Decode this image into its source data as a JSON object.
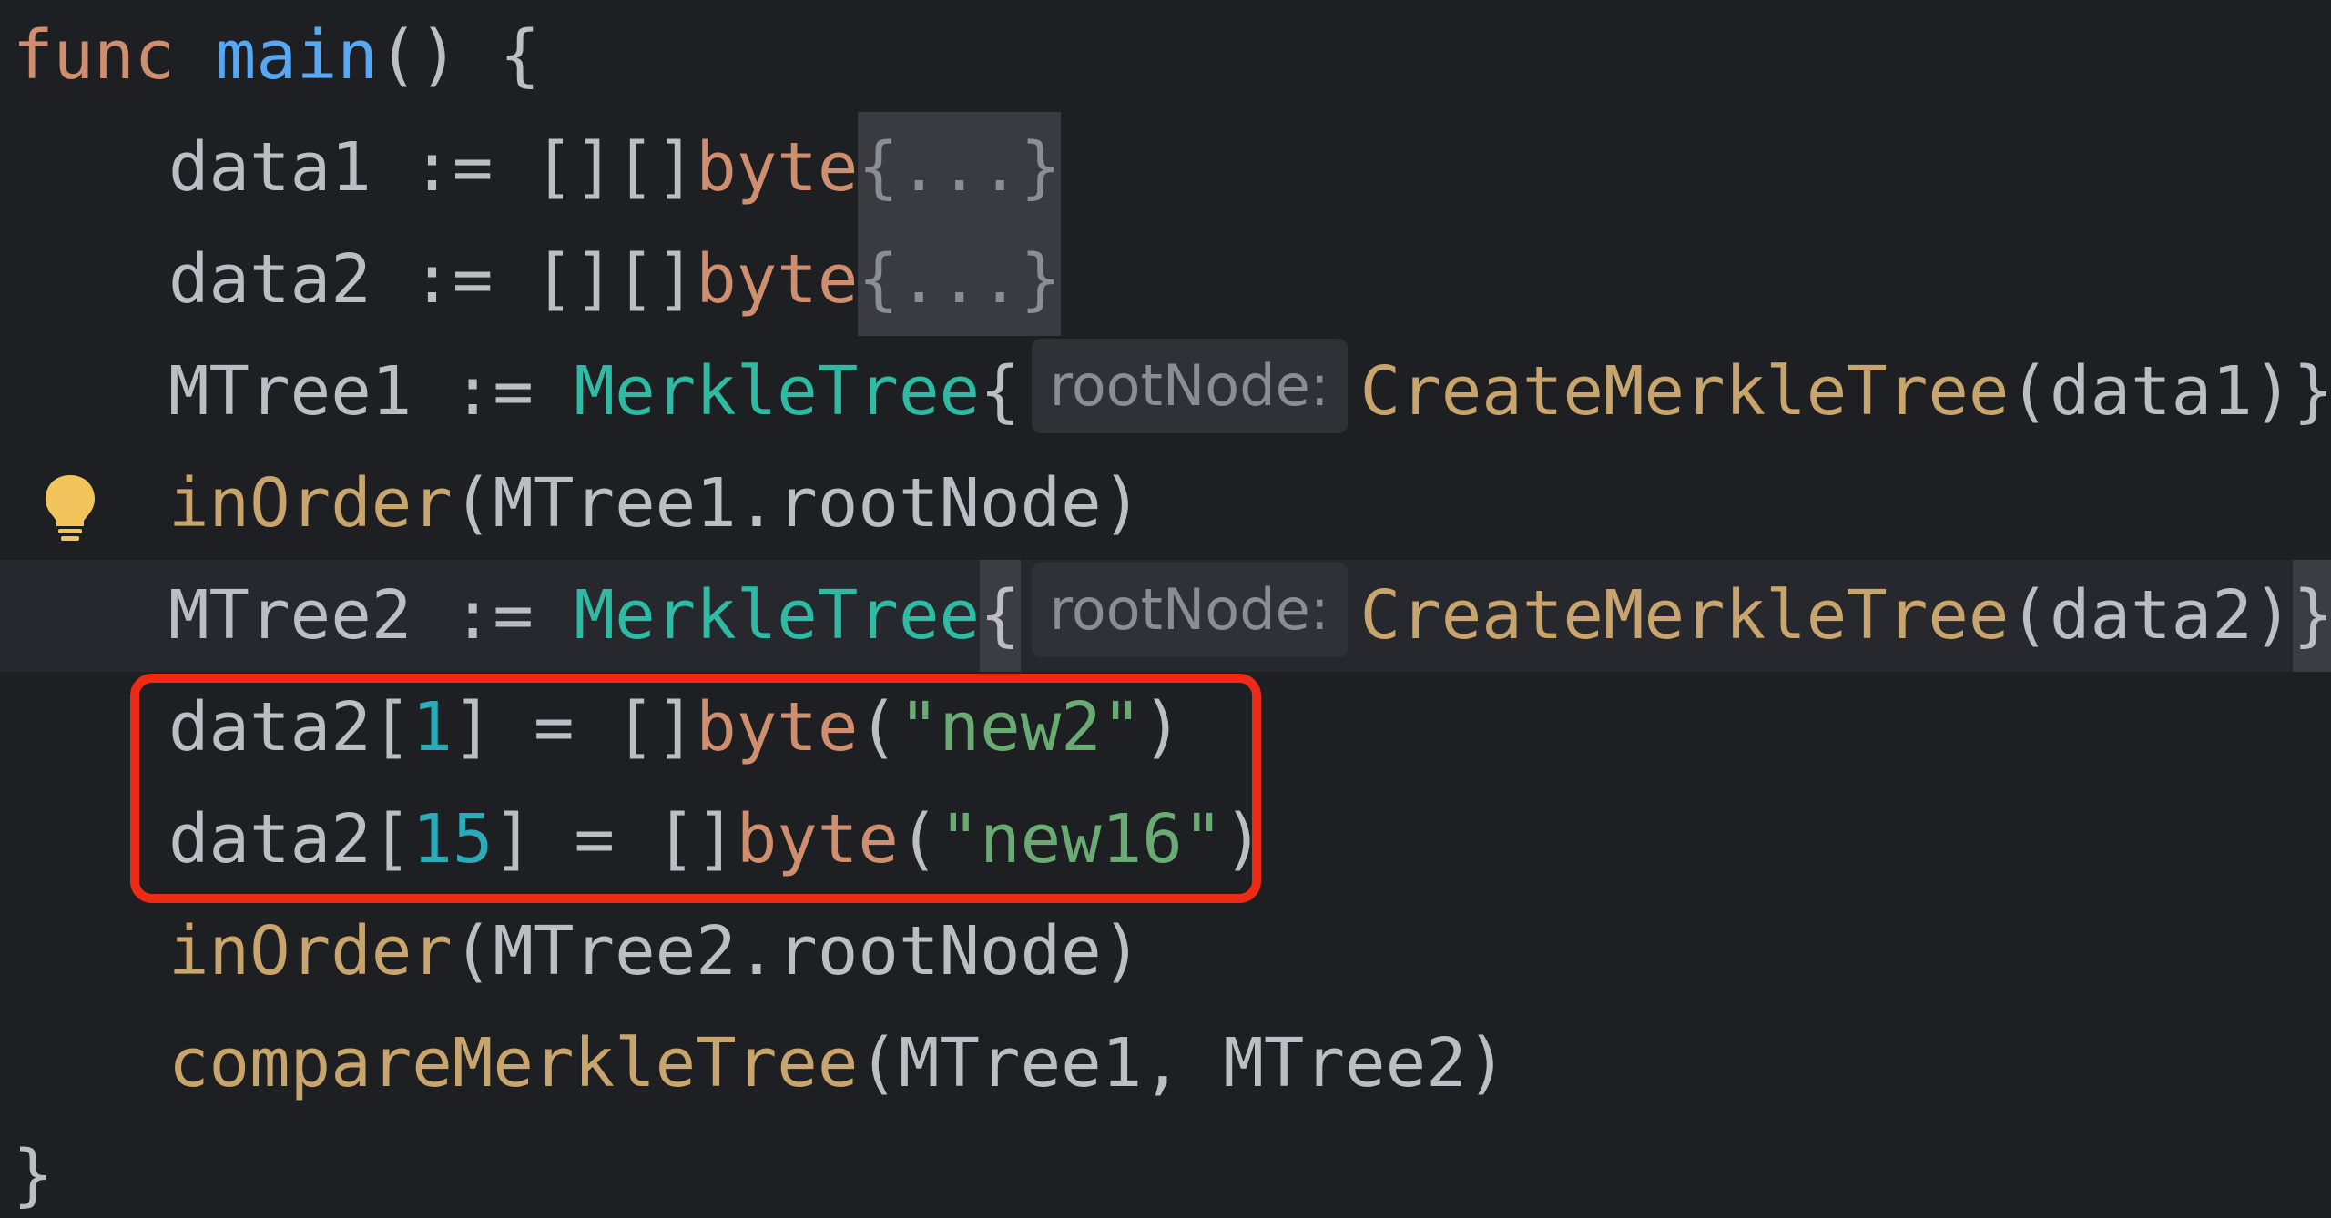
{
  "editor": {
    "language": "Go",
    "theme_colors": {
      "background": "#1e1f22",
      "keyword": "#cf8e6d",
      "function_decl": "#56a8f5",
      "struct_type": "#2fbaa3",
      "function_call": "#c7a56c",
      "string": "#6aab73",
      "number": "#2aacb8",
      "highlight_border": "#ee2a16"
    },
    "lines": [
      {
        "id": "l1",
        "kw": "func",
        "fn": "main",
        "rest": "() {"
      },
      {
        "id": "l2",
        "a": "data1 := [][]",
        "ty": "byte",
        "fold": "{...}"
      },
      {
        "id": "l3",
        "a": "data2 := [][]",
        "ty": "byte",
        "fold": "{...}"
      },
      {
        "id": "l4",
        "a": "MTree1 := ",
        "st": "MerkleTree",
        "brace": "{",
        "hint": "rootNode:",
        "call": "CreateMerkleTree",
        "args": "(data1)}"
      },
      {
        "id": "l5",
        "call": "inOrder",
        "args": "(MTree1.rootNode)",
        "gutter_icon": "lightbulb-icon"
      },
      {
        "id": "l6",
        "a": "MTree2 := ",
        "st": "MerkleTree",
        "brace": "{",
        "hint": "rootNode:",
        "call": "CreateMerkleTree",
        "args": "(data2)",
        "close": "}"
      },
      {
        "id": "l7",
        "a": "data2[",
        "num": "1",
        "b": "] = []",
        "ty": "byte",
        "c": "(",
        "str": "\"new2\"",
        "d": ")"
      },
      {
        "id": "l8",
        "a": "data2[",
        "num": "15",
        "b": "] = []",
        "ty": "byte",
        "c": "(",
        "str": "\"new16\"",
        "d": ")"
      },
      {
        "id": "l9",
        "call": "inOrder",
        "args": "(MTree2.rootNode)"
      },
      {
        "id": "l10",
        "call": "compareMerkleTree",
        "args": "(MTree1, MTree2)"
      },
      {
        "id": "l11",
        "a": "}"
      }
    ]
  }
}
